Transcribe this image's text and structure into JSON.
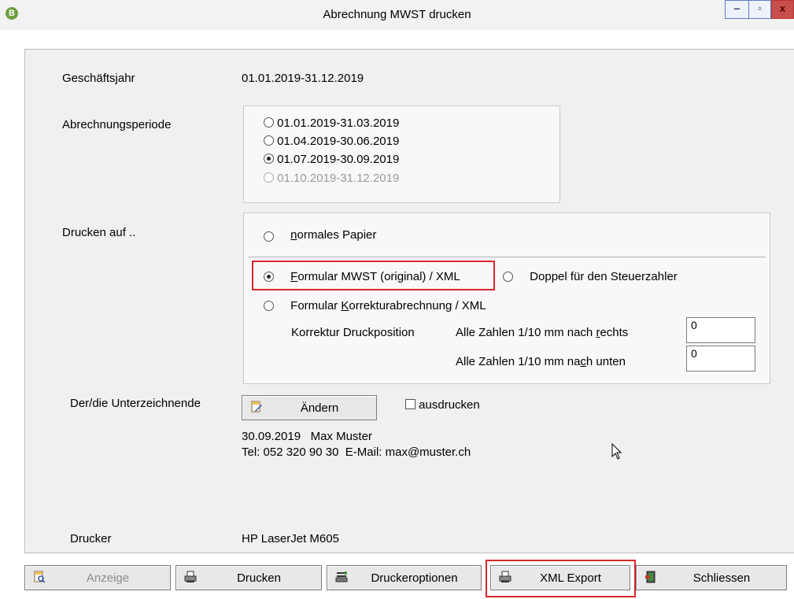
{
  "window": {
    "title": "Abrechnung MWST drucken",
    "app_icon": "app-icon",
    "minimize": "‒",
    "maximize": "▫",
    "close": "x"
  },
  "fields": {
    "geschaeftsjahr": {
      "label": "Geschäftsjahr",
      "value": "01.01.2019-31.12.2019"
    },
    "periode": {
      "label": "Abrechnungsperiode",
      "options": [
        {
          "label": "01.01.2019-31.03.2019",
          "selected": false,
          "enabled": true
        },
        {
          "label": "01.04.2019-30.06.2019",
          "selected": false,
          "enabled": true
        },
        {
          "label": "01.07.2019-30.09.2019",
          "selected": true,
          "enabled": true
        },
        {
          "label": "01.10.2019-31.12.2019",
          "selected": false,
          "enabled": false
        }
      ]
    },
    "drucken_auf": {
      "label": "Drucken auf ..",
      "normal": {
        "underline": "n",
        "rest": "ormales Papier",
        "selected": false
      },
      "formular": {
        "underline": "F",
        "rest": "ormular MWST (original) / XML",
        "selected": true
      },
      "doppel": {
        "label": "Doppel für den Steuerzahler",
        "selected": false
      },
      "korrektur": {
        "before": "Formular ",
        "underline": "K",
        "rest": "orrekturabrechnung / XML",
        "selected": false
      },
      "korrektur_position": "Korrektur Druckposition",
      "rechts": {
        "before": "Alle Zahlen 1/10 mm nach ",
        "underline": "r",
        "rest": "echts",
        "value": "0"
      },
      "unten": {
        "before": "Alle Zahlen 1/10 mm na",
        "underline": "c",
        "rest": "h unten",
        "value": "0"
      }
    },
    "unterzeichnende": {
      "label": "Der/die Unterzeichnende",
      "button": "Ändern",
      "checkbox_label": "ausdrucken",
      "line1": "30.09.2019   Max Muster",
      "line2": "Tel: 052 320 90 30  E-Mail: max@muster.ch"
    },
    "drucker": {
      "label": "Drucker",
      "value": "HP LaserJet M605"
    }
  },
  "buttons": {
    "anzeige": "Anzeige",
    "drucken": "Drucken",
    "druckeroptionen": "Druckeroptionen",
    "xml_export": "XML Export",
    "schliessen": "Schliessen"
  },
  "colors": {
    "highlight": "#d9262c",
    "panel": "#f0f0f0"
  }
}
